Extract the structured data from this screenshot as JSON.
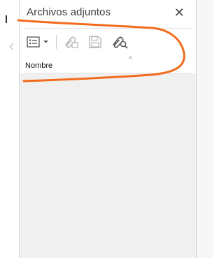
{
  "panel": {
    "title": "Archivos adjuntos",
    "close_glyph": "✕"
  },
  "toolbar": {
    "buttons": [
      {
        "name": "options-menu",
        "icon": "list-options-icon",
        "enabled": true
      },
      {
        "name": "attach-file",
        "icon": "paperclip-add-icon",
        "enabled": false
      },
      {
        "name": "save-attachment",
        "icon": "floppy-disk-icon",
        "enabled": false
      },
      {
        "name": "search-attachments",
        "icon": "paperclip-search-icon",
        "enabled": true
      }
    ]
  },
  "columns": {
    "name_header": "Nombre",
    "sort_indicator": "^"
  },
  "colors": {
    "annotation": "#f26b1d",
    "list_background": "#f0f0f0",
    "enabled_icon": "#555555",
    "disabled_icon": "#b8b8b8"
  }
}
